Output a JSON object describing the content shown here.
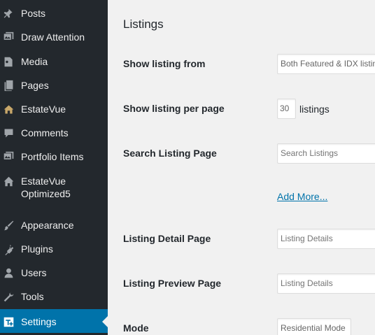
{
  "sidebar": {
    "items": [
      {
        "label": "Posts",
        "icon": "pushpin-icon"
      },
      {
        "label": "Draw Attention",
        "icon": "gallery-icon"
      },
      {
        "label": "Media",
        "icon": "media-icon"
      },
      {
        "label": "Pages",
        "icon": "pages-icon"
      },
      {
        "label": "EstateVue",
        "icon": "house-icon"
      },
      {
        "label": "Comments",
        "icon": "comment-icon"
      },
      {
        "label": "Portfolio Items",
        "icon": "portfolio-icon"
      },
      {
        "label_line1": "EstateVue",
        "label_line2": "Optimized5",
        "icon": "home-icon"
      },
      {
        "label": "Appearance",
        "icon": "paintbrush-icon"
      },
      {
        "label": "Plugins",
        "icon": "plugin-icon"
      },
      {
        "label": "Users",
        "icon": "user-icon"
      },
      {
        "label": "Tools",
        "icon": "wrench-icon"
      },
      {
        "label": "Settings",
        "icon": "settings-icon",
        "active": true
      }
    ]
  },
  "main": {
    "section_title": "Listings",
    "rows": {
      "show_from": {
        "label": "Show listing from",
        "value": "Both Featured & IDX listings"
      },
      "per_page": {
        "label": "Show listing per page",
        "value": "30",
        "suffix": "listings"
      },
      "search_page": {
        "label": "Search Listing Page",
        "placeholder": "Search Listings"
      },
      "add_more": {
        "label": "Add More..."
      },
      "detail_page": {
        "label": "Listing Detail Page",
        "placeholder": "Listing Details"
      },
      "preview_page": {
        "label": "Listing Preview Page",
        "placeholder": "Listing Details"
      },
      "mode": {
        "label": "Mode",
        "value": "Residential Mode"
      }
    }
  },
  "colors": {
    "sidebar_bg": "#23282d",
    "active_bg": "#0073aa",
    "link": "#0073aa",
    "content_bg": "#f1f1f1"
  }
}
